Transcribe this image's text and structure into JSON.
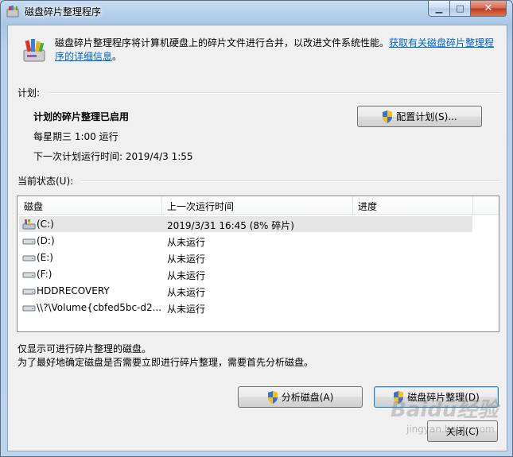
{
  "window": {
    "title": "磁盘碎片整理程序"
  },
  "header": {
    "description": "磁盘碎片整理程序将计算机硬盘上的碎片文件进行合并，以改进文件系统性能。",
    "link_text": "获取有关磁盘碎片整理程序的详细信息",
    "link_end": "。"
  },
  "schedule": {
    "label": "计划:",
    "status": "计划的碎片整理已启用",
    "frequency": "每星期三  1:00 运行",
    "next_run": "下一次计划运行时间: 2019/4/3 1:55",
    "configure_button": "配置计划(S)..."
  },
  "current_status": {
    "label": "当前状态(U):",
    "columns": [
      "磁盘",
      "上一次运行时间",
      "进度"
    ],
    "rows": [
      {
        "disk": "(C:)",
        "last_run": "2019/3/31 16:45 (8% 碎片)",
        "progress": "",
        "icon": "system-drive-icon"
      },
      {
        "disk": "(D:)",
        "last_run": "从未运行",
        "progress": "",
        "icon": "drive-icon"
      },
      {
        "disk": "(E:)",
        "last_run": "从未运行",
        "progress": "",
        "icon": "drive-icon"
      },
      {
        "disk": "(F:)",
        "last_run": "从未运行",
        "progress": "",
        "icon": "drive-icon"
      },
      {
        "disk": "HDDRECOVERY",
        "last_run": "从未运行",
        "progress": "",
        "icon": "drive-icon"
      },
      {
        "disk": "\\\\?\\Volume{cbfed5bc-d2...",
        "last_run": "从未运行",
        "progress": "",
        "icon": "drive-icon"
      }
    ]
  },
  "notes": {
    "line1": "仅显示可进行碎片整理的磁盘。",
    "line2": "为了最好地确定磁盘是否需要立即进行碎片整理，需要首先分析磁盘。"
  },
  "buttons": {
    "analyze": "分析磁盘(A)",
    "defrag": "磁盘碎片整理(D)",
    "close": "关闭(C)"
  },
  "watermark": {
    "brand": "Baidu经验",
    "url": "jingyan.baidu.com"
  },
  "colors": {
    "link": "#0066cc",
    "selected_row": "#e6e6e6"
  }
}
